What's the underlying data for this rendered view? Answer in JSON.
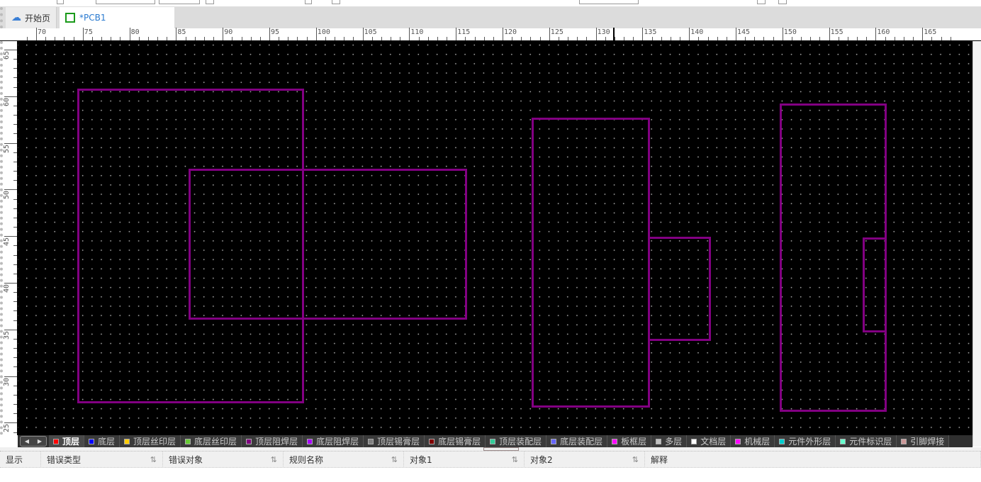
{
  "tabs": [
    {
      "label": "开始页",
      "icon": "cloud-icon"
    },
    {
      "label": "*PCB1",
      "icon": "pcb-icon"
    }
  ],
  "ruler": {
    "x_labels": [
      "70",
      "75",
      "80",
      "85",
      "90",
      "95",
      "100",
      "105",
      "110",
      "115",
      "120",
      "125",
      "130",
      "135",
      "140",
      "145",
      "150",
      "155",
      "160",
      "165"
    ],
    "y_labels": [
      "65",
      "60",
      "55",
      "50",
      "45",
      "40",
      "35",
      "30",
      "25"
    ]
  },
  "layers": [
    {
      "label": "顶层",
      "color": "#ff0000",
      "active": true
    },
    {
      "label": "底层",
      "color": "#0000ff"
    },
    {
      "label": "顶层丝印层",
      "color": "#ffcc00"
    },
    {
      "label": "底层丝印层",
      "color": "#66cc33"
    },
    {
      "label": "顶层阻焊层",
      "color": "#800080"
    },
    {
      "label": "底层阻焊层",
      "color": "#aa00ff"
    },
    {
      "label": "顶层锡膏层",
      "color": "#808080"
    },
    {
      "label": "底层锡膏层",
      "color": "#800000"
    },
    {
      "label": "顶层装配层",
      "color": "#33cc99"
    },
    {
      "label": "底层装配层",
      "color": "#6666ff"
    },
    {
      "label": "板框层",
      "color": "#ff00ff"
    },
    {
      "label": "多层",
      "color": "#c0c0c0"
    },
    {
      "label": "文档层",
      "color": "#ffffff"
    },
    {
      "label": "机械层",
      "color": "#ff00ff"
    },
    {
      "label": "元件外形层",
      "color": "#00cccc"
    },
    {
      "label": "元件标识层",
      "color": "#66ffcc"
    },
    {
      "label": "引脚焊接",
      "color": "#cc9999"
    }
  ],
  "drc_table": {
    "columns": [
      {
        "label": "显示",
        "sortable": false
      },
      {
        "label": "错误类型",
        "sortable": true
      },
      {
        "label": "错误对象",
        "sortable": true
      },
      {
        "label": "规则名称",
        "sortable": true
      },
      {
        "label": "对象1",
        "sortable": true
      },
      {
        "label": "对象2",
        "sortable": true
      },
      {
        "label": "解释",
        "sortable": false
      }
    ]
  },
  "colors": {
    "outline": "#820082",
    "canvas": "#000000"
  }
}
